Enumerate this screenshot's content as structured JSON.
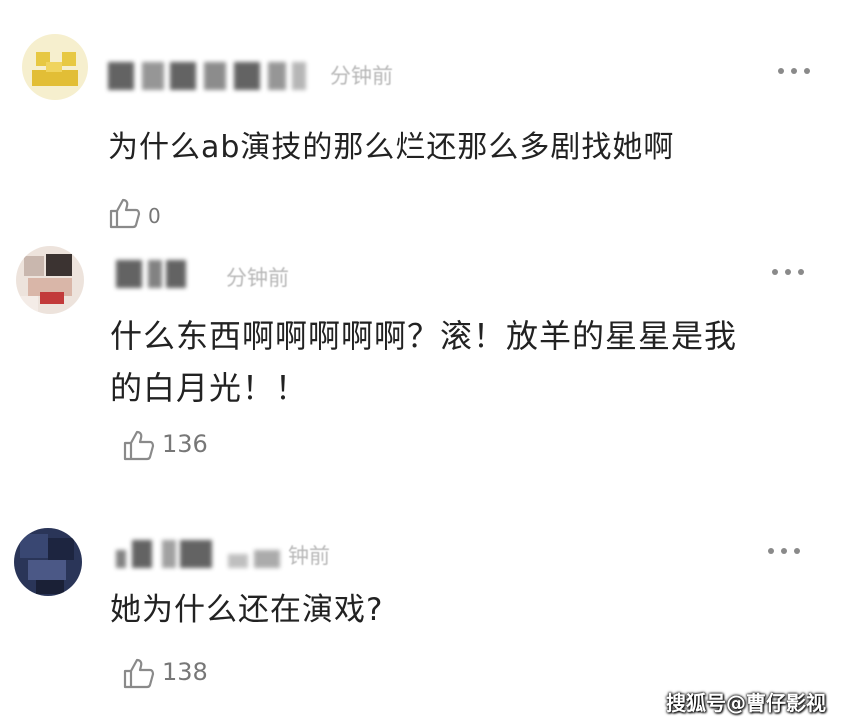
{
  "comments": [
    {
      "time": "分钟前",
      "text": "为什么ab演技的那么烂还那么多剧找她啊",
      "likes": "0"
    },
    {
      "time": "分钟前",
      "text": "什么东西啊啊啊啊啊？滚！放羊的星星是我\n的白月光！！",
      "likes": "136"
    },
    {
      "time": "钟前",
      "text": "她为什么还在演戏?",
      "likes": "138"
    }
  ],
  "watermark": "搜狐号@曹仔影视",
  "icons": {
    "like": "thumbs-up-icon",
    "more": "more-dots-icon"
  },
  "colors": {
    "text": "#222222",
    "meta": "#b8b8b8",
    "count": "#777777"
  }
}
